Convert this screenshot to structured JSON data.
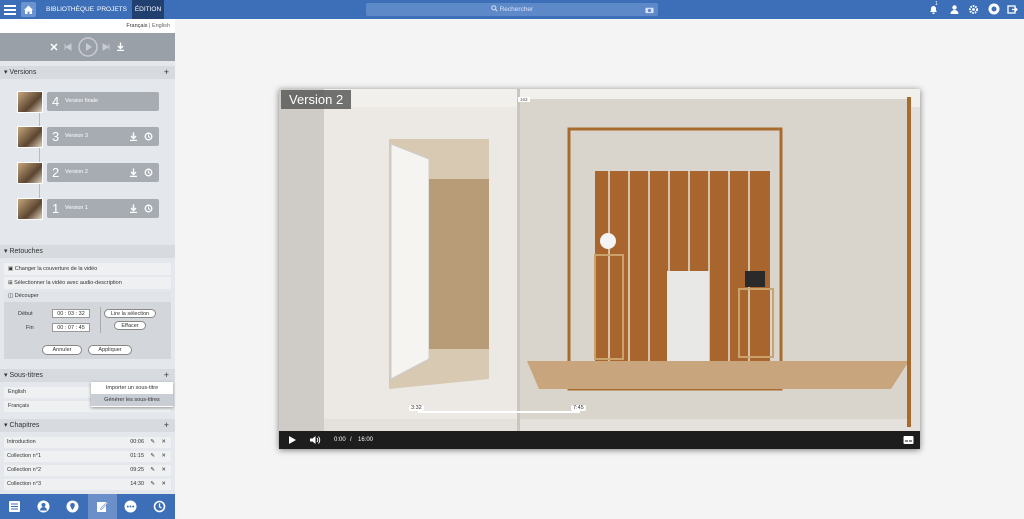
{
  "topbar": {
    "nav": [
      "BIBLIOTHÈQUE",
      "PROJETS",
      "ÉDITION"
    ],
    "search_placeholder": "Rechercher",
    "notification_count": "1"
  },
  "lang": {
    "fr": "Français",
    "sep": "|",
    "en": "English"
  },
  "versions": {
    "title": "Versions",
    "items": [
      {
        "num": "4",
        "label": "Version finale"
      },
      {
        "num": "3",
        "label": "Version 3"
      },
      {
        "num": "2",
        "label": "Version 2"
      },
      {
        "num": "1",
        "label": "Version 1"
      }
    ]
  },
  "retouches": {
    "title": "Retouches",
    "items": [
      "Changer la couverture de la vidéo",
      "Sélectionner la vidéo avec audio-description"
    ],
    "cut": {
      "title": "Découper",
      "start_label": "Début",
      "start_value": "00 : 03 : 32",
      "end_label": "Fin",
      "end_value": "00 : 07 : 45",
      "play_sel": "Lire la sélection",
      "clear": "Effacer",
      "cancel": "Annuler",
      "apply": "Appliquer"
    }
  },
  "subtitles": {
    "title": "Sous-titres",
    "items": [
      "English",
      "Français"
    ],
    "menu": [
      "Importer un sous-titre",
      "Générer les sous-titres"
    ]
  },
  "chapters": {
    "title": "Chapitres",
    "items": [
      {
        "name": "Introduction",
        "time": "00:06"
      },
      {
        "name": "Collection n°1",
        "time": "01:15"
      },
      {
        "name": "Collection n°2",
        "time": "09:25"
      },
      {
        "name": "Collection n°3",
        "time": "14:30"
      }
    ]
  },
  "video": {
    "title": "Version 2",
    "current": "0:00",
    "sep": "/",
    "duration": "16:00",
    "marker_start": "3:32",
    "marker_end": "7:45",
    "overlay_tag": "163"
  },
  "colors": {
    "brand": "#3d6fb8"
  }
}
